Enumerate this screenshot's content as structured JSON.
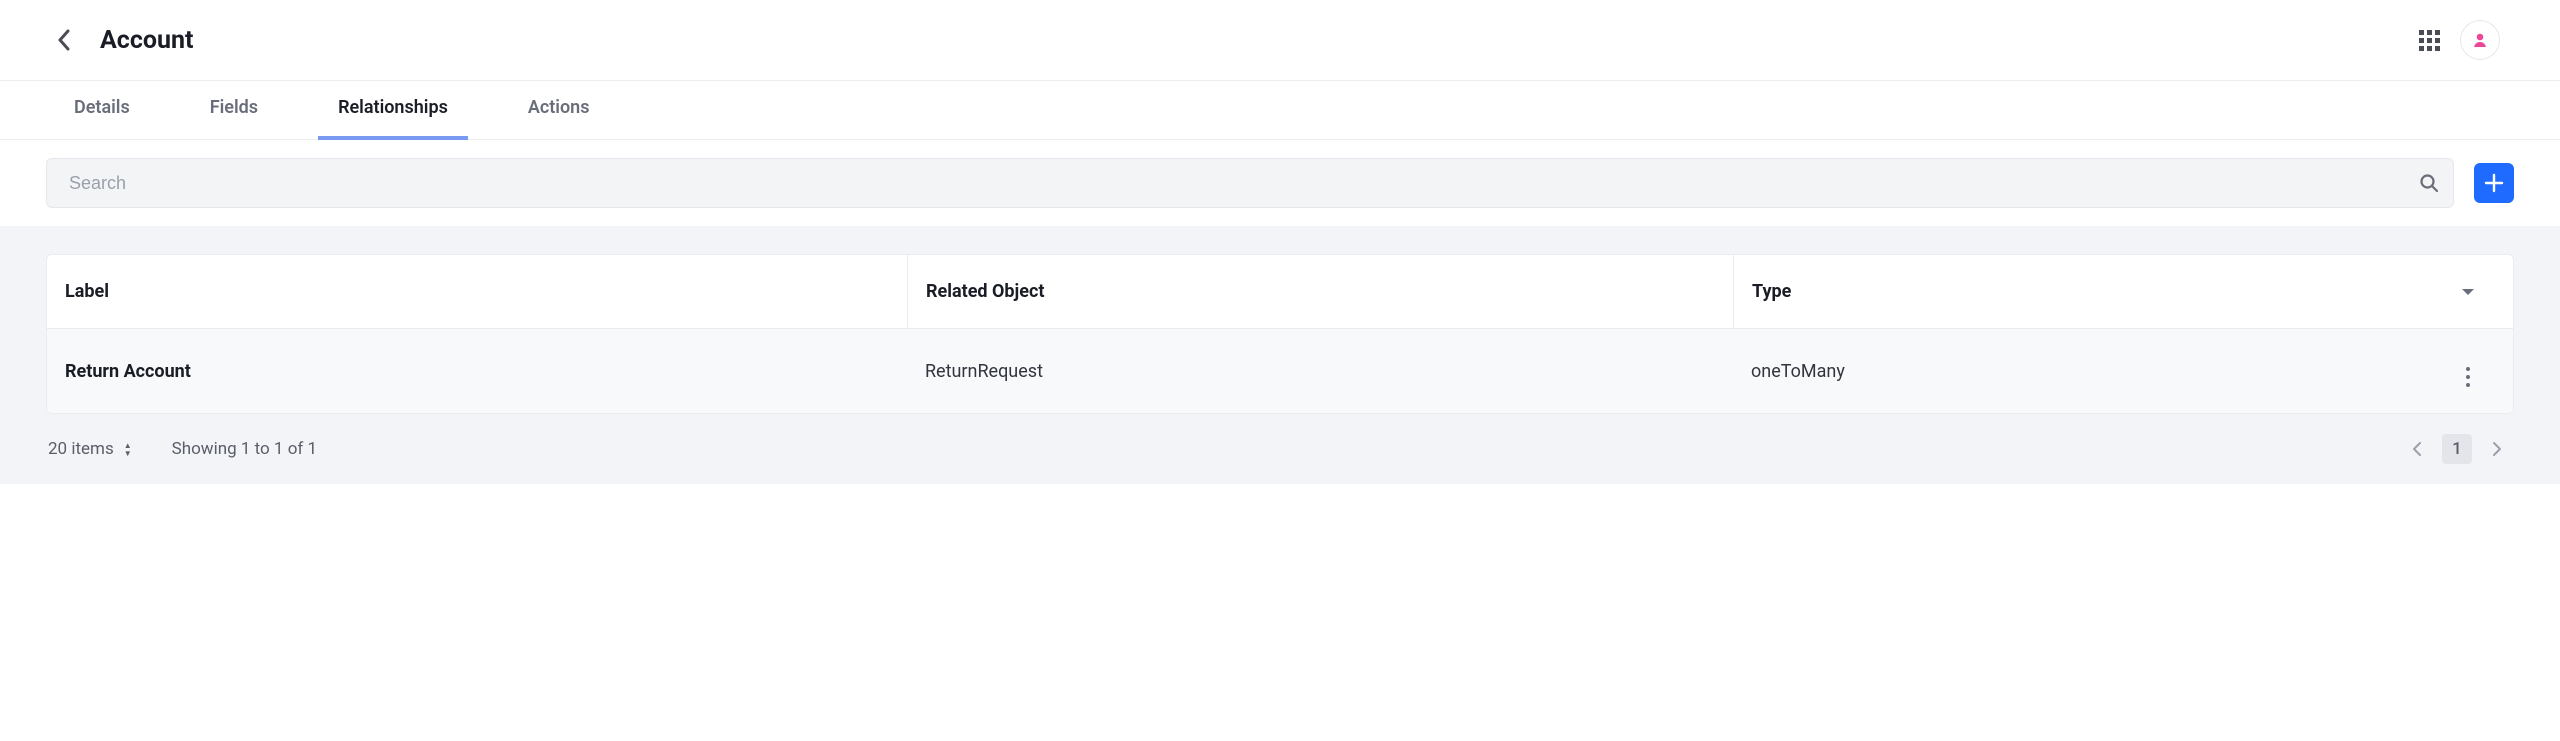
{
  "header": {
    "title": "Account"
  },
  "tabs": [
    {
      "label": "Details"
    },
    {
      "label": "Fields"
    },
    {
      "label": "Relationships"
    },
    {
      "label": "Actions"
    }
  ],
  "search": {
    "placeholder": "Search"
  },
  "table": {
    "headers": {
      "label": "Label",
      "relatedObject": "Related Object",
      "type": "Type"
    },
    "rows": [
      {
        "label": "Return Account",
        "relatedObject": "ReturnRequest",
        "type": "oneToMany"
      }
    ]
  },
  "footer": {
    "itemsPerPage": "20 items",
    "showing": "Showing 1 to 1 of 1",
    "currentPage": "1"
  }
}
